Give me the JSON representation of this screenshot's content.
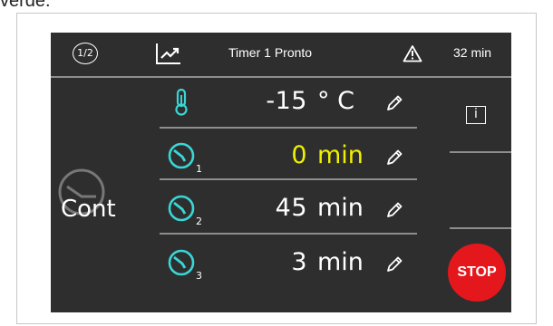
{
  "page_caption": "verde.",
  "header": {
    "page_indicator": "1/2",
    "title": "Timer 1 Pronto",
    "remaining": "32 min"
  },
  "rows": [
    {
      "value": "-15",
      "unit": "° C",
      "icon": "thermometer-icon"
    },
    {
      "value": "0",
      "unit": "min",
      "index": "1",
      "icon": "timer-icon",
      "highlight_color": "#f0f000"
    },
    {
      "value": "45",
      "unit": "min",
      "index": "2",
      "icon": "timer-icon"
    },
    {
      "value": "3",
      "unit": "min",
      "index": "3",
      "icon": "timer-icon"
    }
  ],
  "mode_label": "Cont",
  "info_label": "i",
  "stop_label": "STOP",
  "colors": {
    "screen_bg": "#2e2e2e",
    "accent": "#3ad6d6",
    "highlight": "#f0f000",
    "stop": "#e4181c"
  }
}
